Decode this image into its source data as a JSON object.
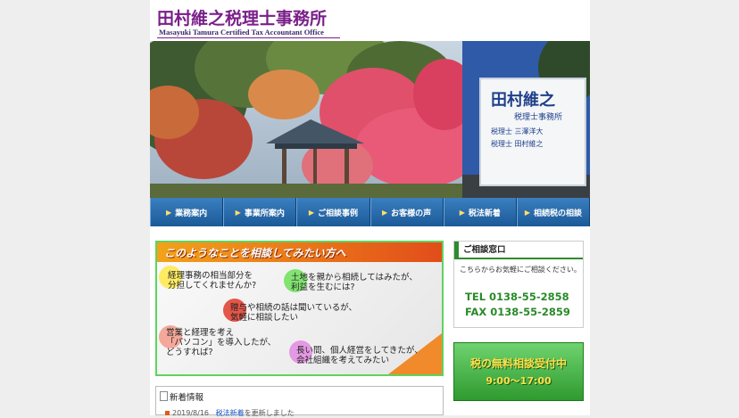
{
  "header": {
    "title": "田村維之税理士事務所",
    "subtitle": "Masayuki Tamura Certified Tax Accountant Office"
  },
  "hero": {
    "sign_name": "田村維之",
    "sign_office": "税理士事務所",
    "sign_line1": "税理士 三澤洋大",
    "sign_line2": "税理士 田村維之"
  },
  "nav": {
    "items": [
      {
        "label": "業務案内"
      },
      {
        "label": "事業所案内"
      },
      {
        "label": "ご相談事例"
      },
      {
        "label": "お客様の声"
      },
      {
        "label": "税法新着"
      },
      {
        "label": "相続税の相談"
      }
    ]
  },
  "promo": {
    "heading": "このようなことを相談してみたい方へ",
    "items": [
      "経理事務の相当部分を\n分担してくれませんか?",
      "土地を親から相続してはみたが、\n利益を生むには?",
      "贈与や相続の話は聞いているが、\n気軽に相談したい",
      "営業と経理を考え\n「パソコン」を導入したが、\nどうすれば?",
      "長い間、個人経営をしてきたが、\n会社組織を考えてみたい"
    ]
  },
  "news": {
    "heading": "新着情報",
    "item_date": "2019/8/16",
    "item_link": "税法新着",
    "item_text": "を更新しました"
  },
  "sidebar": {
    "consult_title": "ご相談窓口",
    "consult_desc": "こちらからお気軽にご相談ください。",
    "tel": "TEL 0138-55-2858",
    "fax": "FAX 0138-55-2859",
    "free_line1": "税の無料相談受付中",
    "free_line2": "9:00〜17:00"
  }
}
